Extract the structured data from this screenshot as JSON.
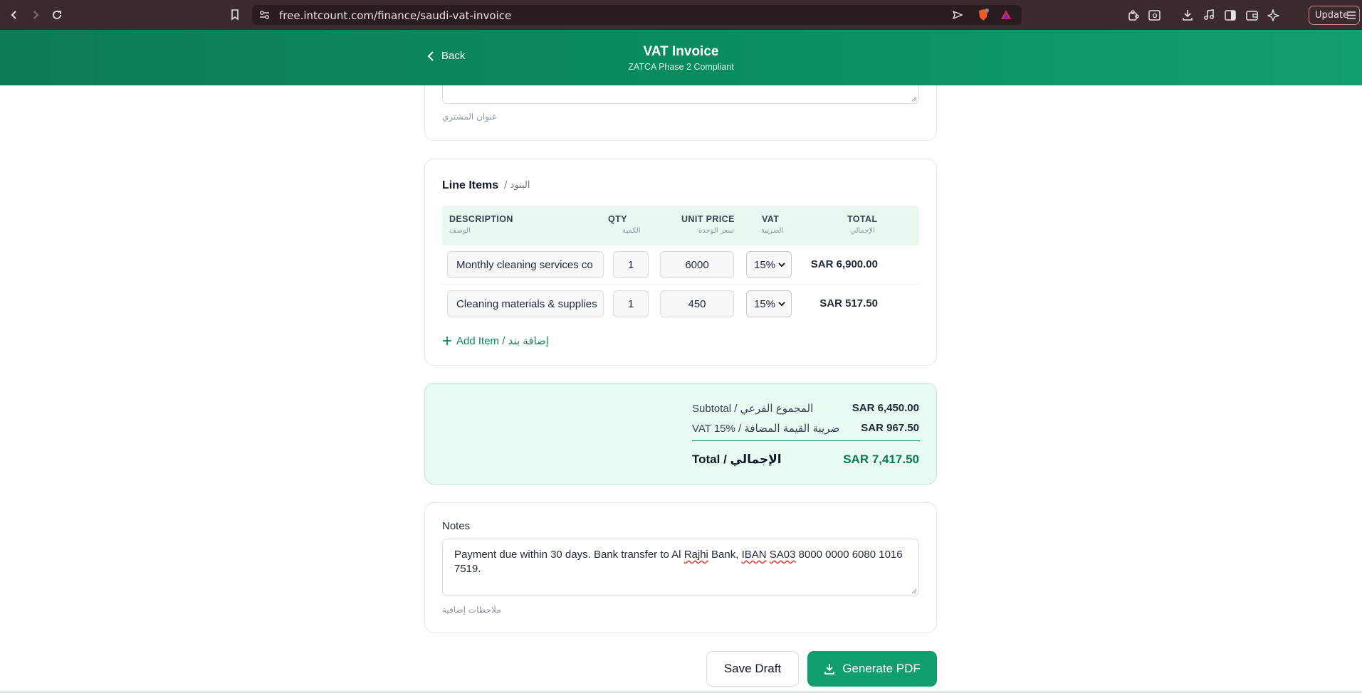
{
  "browser": {
    "url": "free.intcount.com/finance/saudi-vat-invoice",
    "update_label": "Update"
  },
  "header": {
    "back_label": "Back",
    "title": "VAT Invoice",
    "subtitle": "ZATCA Phase 2 Compliant"
  },
  "buyer": {
    "address_hint_ar": "عنوان المشتري"
  },
  "line_items": {
    "title": "Line Items",
    "title_ar": "/ البنود",
    "columns": [
      {
        "label": "DESCRIPTION",
        "label_ar": "الوصف"
      },
      {
        "label": "QTY",
        "label_ar": "الكمية"
      },
      {
        "label": "UNIT PRICE",
        "label_ar": "سعر الوحدة"
      },
      {
        "label": "VAT",
        "label_ar": "الضريبة"
      },
      {
        "label": "TOTAL",
        "label_ar": "الإجمالي"
      }
    ],
    "rows": [
      {
        "description": "Monthly cleaning services co",
        "qty": "1",
        "unit_price": "6000",
        "vat": "15%",
        "total": "SAR 6,900.00"
      },
      {
        "description": "Cleaning materials & supplies",
        "qty": "1",
        "unit_price": "450",
        "vat": "15%",
        "total": "SAR 517.50"
      }
    ],
    "add_item_label": "Add Item / إضافة بند"
  },
  "summary": {
    "subtotal_label": "Subtotal / المجموع الفرعي",
    "subtotal_value": "SAR 6,450.00",
    "vat_label": "VAT 15% / ضريبة القيمة المضافة",
    "vat_value": "SAR 967.50",
    "total_label": "Total / الإجمالي",
    "total_value": "SAR 7,417.50"
  },
  "notes": {
    "label": "Notes",
    "text_before": "Payment due within 30 days. Bank transfer to Al ",
    "word_rajhi": "Rajhi",
    "text_mid1": " Bank, ",
    "word_iban": "IBAN",
    "text_mid2": " ",
    "word_sa03": "SA03",
    "text_after": " 8000 0000 6080 1016 7519.",
    "hint_ar": "ملاحظات إضافية"
  },
  "actions": {
    "save_draft_label": "Save Draft",
    "generate_pdf_label": "Generate PDF"
  },
  "colors": {
    "brand_green": "#0a8a5c",
    "header_gradient_end": "#12a06d",
    "summary_bg": "#e9faf1",
    "chrome_bg": "#3b2a2e"
  }
}
